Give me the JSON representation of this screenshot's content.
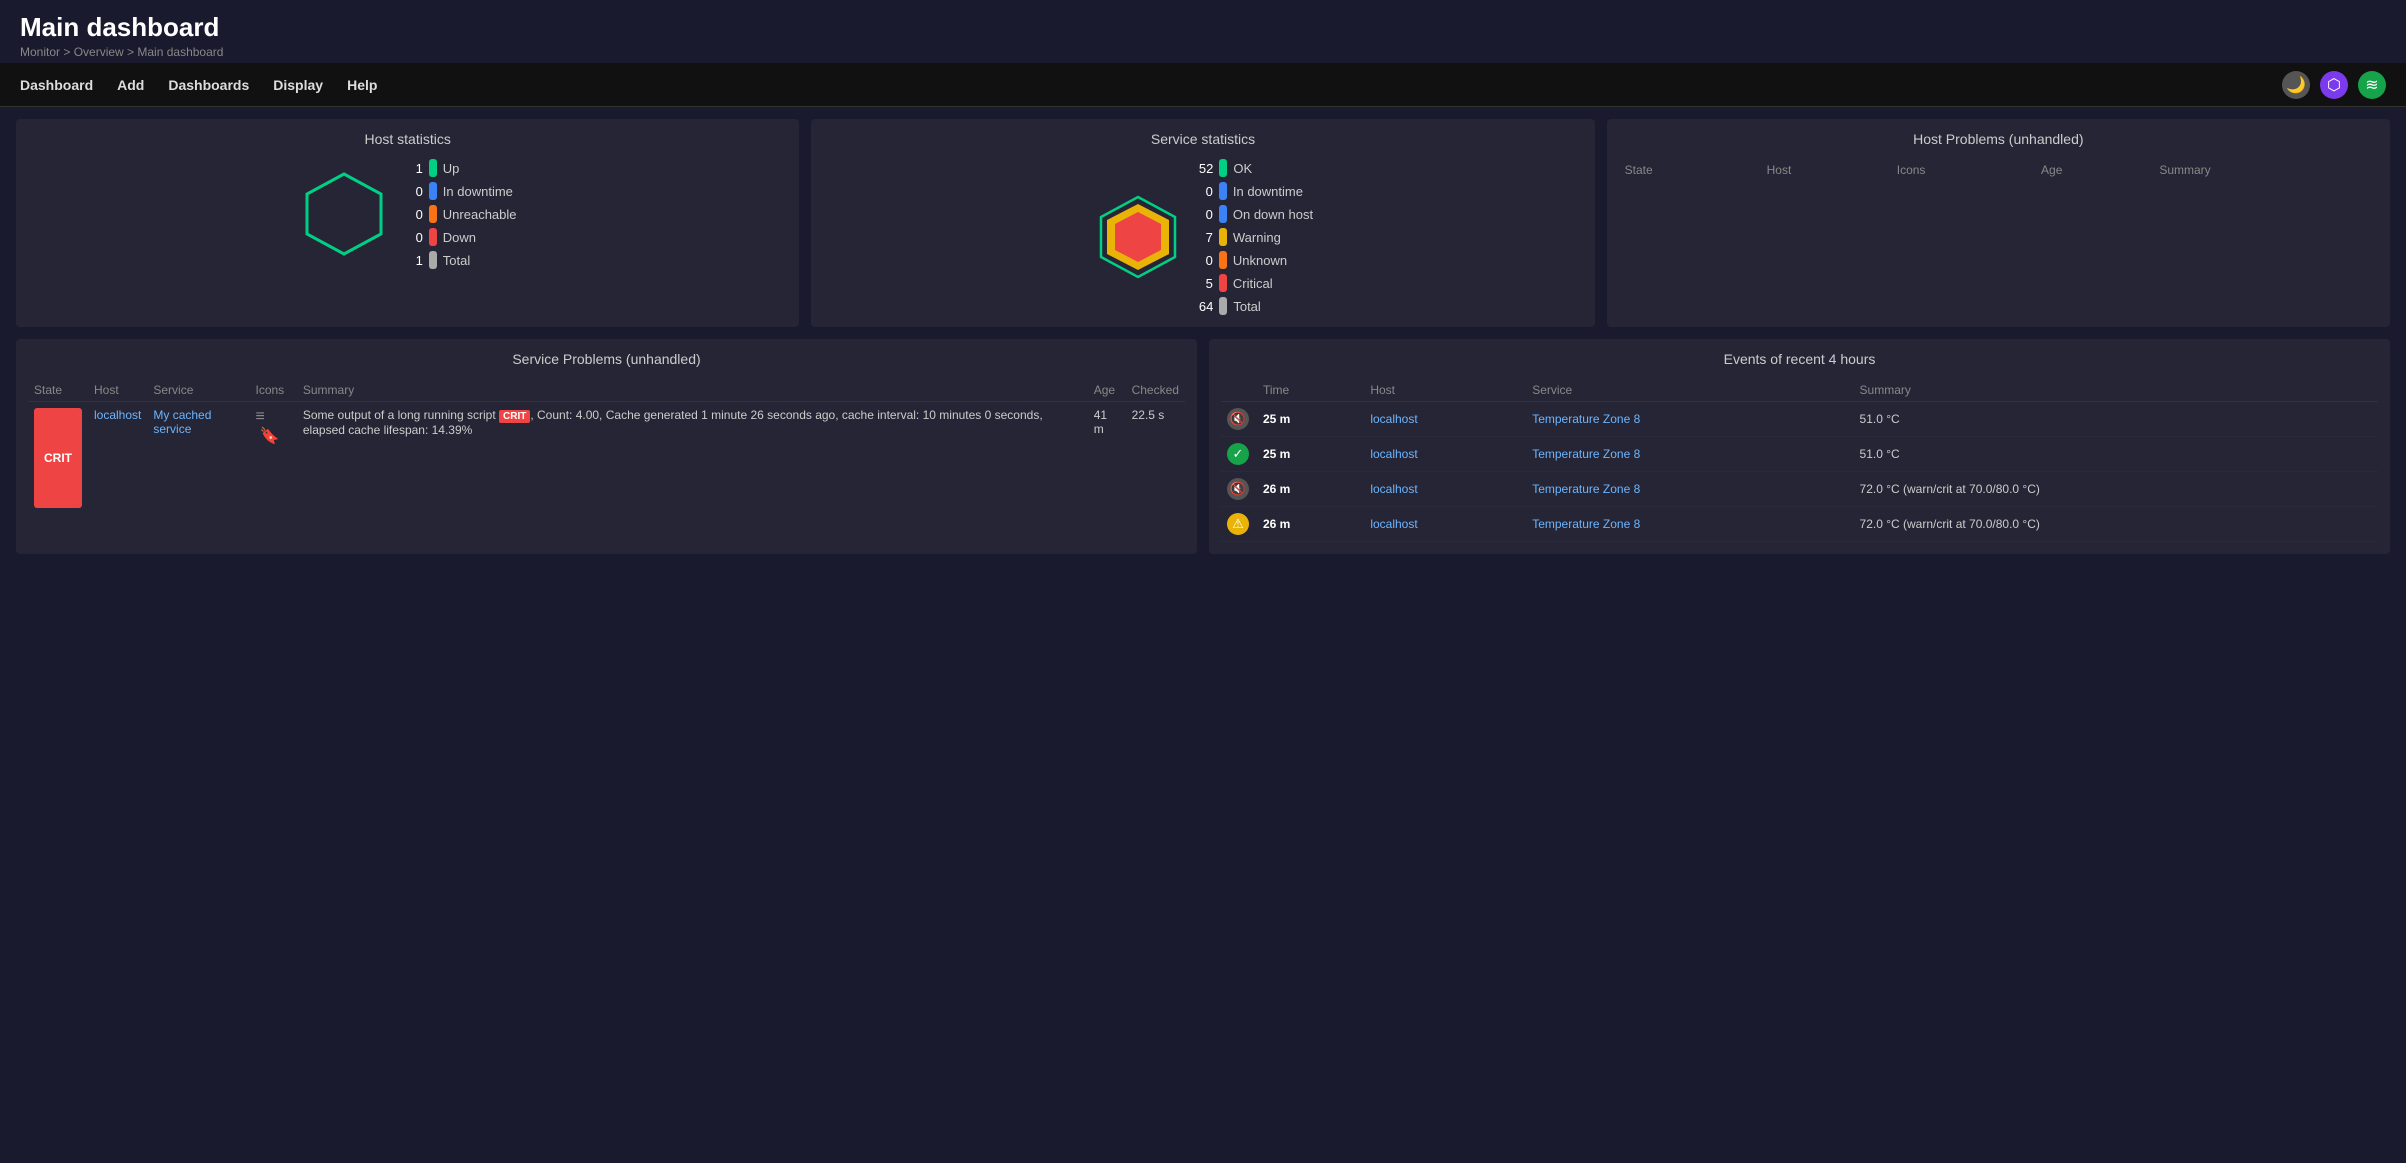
{
  "header": {
    "title": "Main dashboard",
    "breadcrumb": "Monitor > Overview > Main dashboard"
  },
  "nav": {
    "items": [
      "Dashboard",
      "Add",
      "Dashboards",
      "Display",
      "Help"
    ]
  },
  "host_statistics": {
    "title": "Host statistics",
    "stats": [
      {
        "label": "Up",
        "count": 1,
        "color": "green"
      },
      {
        "label": "In downtime",
        "count": 0,
        "color": "blue"
      },
      {
        "label": "Unreachable",
        "count": 0,
        "color": "orange"
      },
      {
        "label": "Down",
        "count": 0,
        "color": "red"
      },
      {
        "label": "Total",
        "count": 1,
        "color": "white"
      }
    ]
  },
  "service_statistics": {
    "title": "Service statistics",
    "stats": [
      {
        "label": "OK",
        "count": 52,
        "color": "green"
      },
      {
        "label": "In downtime",
        "count": 0,
        "color": "blue"
      },
      {
        "label": "On down host",
        "count": 0,
        "color": "blue"
      },
      {
        "label": "Warning",
        "count": 7,
        "color": "yellow"
      },
      {
        "label": "Unknown",
        "count": 0,
        "color": "orange"
      },
      {
        "label": "Critical",
        "count": 5,
        "color": "red"
      },
      {
        "label": "Total",
        "count": 64,
        "color": "white"
      }
    ]
  },
  "host_problems": {
    "title": "Host Problems (unhandled)",
    "columns": [
      "State",
      "Host",
      "Icons",
      "Age",
      "Summary"
    ]
  },
  "service_problems": {
    "title": "Service Problems (unhandled)",
    "columns": [
      "State",
      "Host",
      "Service",
      "Icons",
      "Summary",
      "Age",
      "Checked"
    ],
    "rows": [
      {
        "state": "CRIT",
        "host": "localhost",
        "service": "My cached service",
        "summary": "Some output of a long running script CRIT, Count: 4.00, Cache generated 1 minute 26 seconds ago, cache interval: 10 minutes 0 seconds, elapsed cache lifespan: 14.39%",
        "age": "41 m",
        "checked": "22.5 s"
      }
    ]
  },
  "events": {
    "title": "Events of recent 4 hours",
    "columns": [
      "Time",
      "Host",
      "Service",
      "Summary"
    ],
    "rows": [
      {
        "icon": "grey",
        "time": "25 m",
        "host": "localhost",
        "service": "Temperature Zone 8",
        "summary": "51.0 °C"
      },
      {
        "icon": "green",
        "time": "25 m",
        "host": "localhost",
        "service": "Temperature Zone 8",
        "summary": "51.0 °C"
      },
      {
        "icon": "grey",
        "time": "26 m",
        "host": "localhost",
        "service": "Temperature Zone 8",
        "summary": "72.0 °C (warn/crit at 70.0/80.0 °C)"
      },
      {
        "icon": "yellow",
        "time": "26 m",
        "host": "localhost",
        "service": "Temperature Zone 8",
        "summary": "72.0 °C (warn/crit at 70.0/80.0 °C)"
      }
    ]
  }
}
